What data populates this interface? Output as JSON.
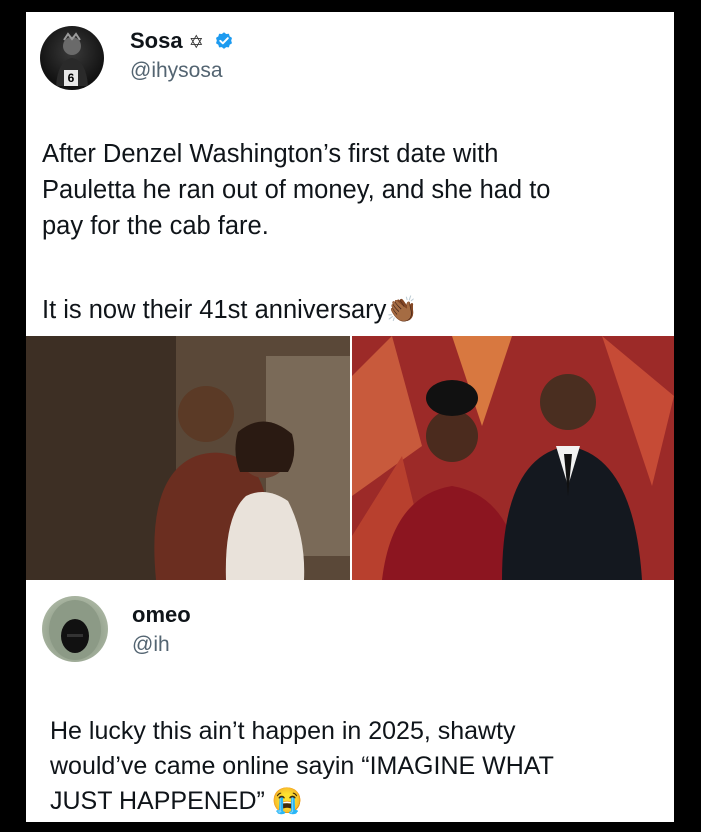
{
  "tweet1": {
    "name": "Sosa",
    "name_glyph": "✡",
    "handle": "@ihysosa",
    "avatar_jersey_number": "6",
    "text_lines": [
      "After Denzel Washington’s first date with",
      "Pauletta he ran out of money, and she had to",
      "pay for the cab fare."
    ],
    "text_line2": "It is now their 41st anniversary",
    "emoji": "👏🏾"
  },
  "tweet2": {
    "name": "omeo",
    "handle": "@ih",
    "text_lines": [
      "He lucky this ain’t happen in 2025, shawty",
      "would’ve came online sayin “IMAGINE WHAT",
      "JUST HAPPENED”"
    ],
    "emoji": "😭"
  },
  "colors": {
    "verified_blue": "#1d9bf0",
    "text": "#0f1419",
    "handle": "#536471"
  }
}
